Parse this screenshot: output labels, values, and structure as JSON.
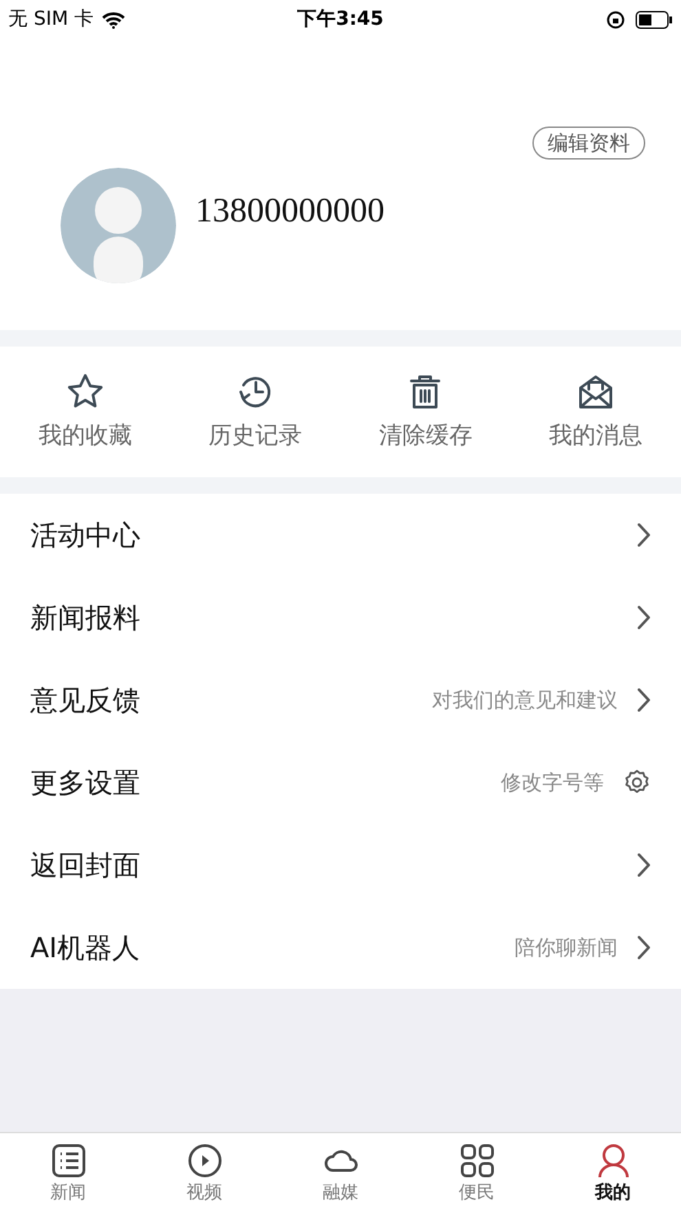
{
  "status_bar": {
    "carrier": "无 SIM 卡",
    "time": "下午3:45"
  },
  "profile": {
    "edit_button": "编辑资料",
    "phone": "13800000000"
  },
  "quick_actions": [
    {
      "label": "我的收藏"
    },
    {
      "label": "历史记录"
    },
    {
      "label": "清除缓存"
    },
    {
      "label": "我的消息"
    }
  ],
  "menu": [
    {
      "label": "活动中心",
      "kind": "arrow"
    },
    {
      "label": "新闻报料",
      "kind": "arrow"
    },
    {
      "label": "意见反馈",
      "hint": "对我们的意见和建议",
      "kind": "arrow"
    },
    {
      "label": "更多设置",
      "hint": "修改字号等",
      "kind": "gear"
    },
    {
      "label": "返回封面",
      "kind": "arrow"
    },
    {
      "label": "AI机器人",
      "hint": "陪你聊新闻",
      "kind": "arrow"
    }
  ],
  "tab_bar": [
    {
      "label": "新闻",
      "selected": false
    },
    {
      "label": "视频",
      "selected": false
    },
    {
      "label": "融媒",
      "selected": false
    },
    {
      "label": "便民",
      "selected": false
    },
    {
      "label": "我的",
      "selected": true
    }
  ]
}
